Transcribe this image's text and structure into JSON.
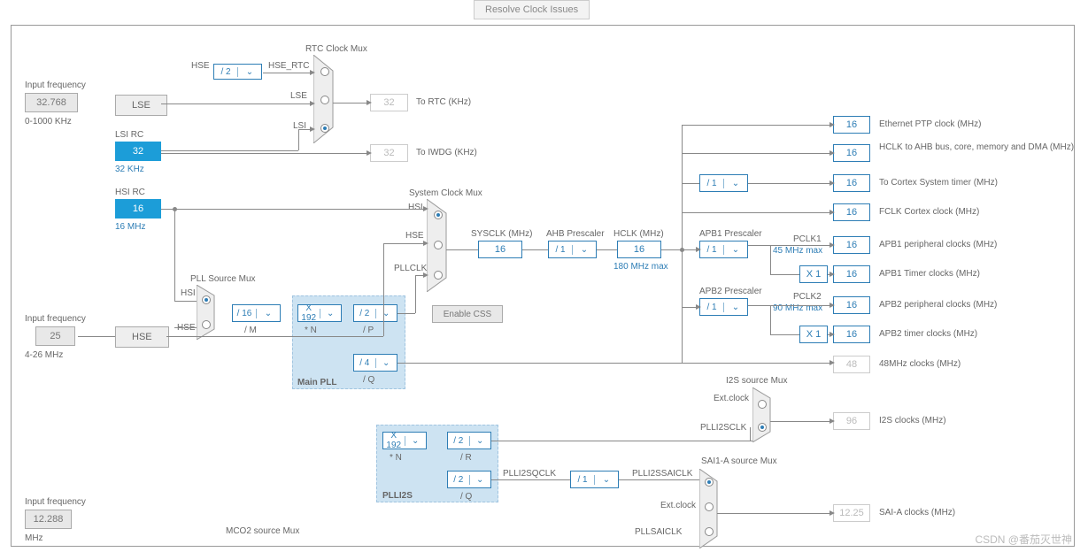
{
  "topbar": {
    "resolve": "Resolve Clock Issues"
  },
  "inputs": {
    "lse": {
      "title": "Input frequency",
      "val": "32.768",
      "range": "0-1000 KHz"
    },
    "hse": {
      "title": "Input frequency",
      "val": "25",
      "range": "4-26 MHz"
    },
    "i2s": {
      "title": "Input frequency",
      "val": "12.288",
      "range": "MHz"
    }
  },
  "src": {
    "lse": "LSE",
    "hse": "HSE",
    "lsi_rc": "LSI RC",
    "lsi_val": "32",
    "lsi_note": "32 KHz",
    "hsi_rc": "HSI RC",
    "hsi_val": "16",
    "hsi_note": "16 MHz"
  },
  "rtc": {
    "title": "RTC Clock Mux",
    "hse_div": "/ 2",
    "hse_rtc": "HSE_RTC",
    "lse": "LSE",
    "lsi": "LSI",
    "hse": "HSE",
    "to_rtc": "To RTC (KHz)",
    "rtc_val": "32",
    "to_iwdg": "To IWDG (KHz)",
    "iwdg_val": "32"
  },
  "pllsrc": {
    "title": "PLL Source Mux",
    "hsi": "HSI",
    "hse": "HSE",
    "m": "/ 16",
    "m_lbl": "/ M"
  },
  "mainpll": {
    "title": "Main PLL",
    "n": "X 192",
    "n_lbl": "* N",
    "p": "/ 2",
    "p_lbl": "/ P",
    "q": "/ 4",
    "q_lbl": "/ Q"
  },
  "plli2s": {
    "title": "PLLI2S",
    "n": "X 192",
    "n_lbl": "* N",
    "r": "/ 2",
    "r_lbl": "/ R",
    "q": "/ 2",
    "q_lbl": "/ Q"
  },
  "sysclk": {
    "title": "System Clock Mux",
    "hsi": "HSI",
    "hse": "HSE",
    "pllclk": "PLLCLK",
    "css": "Enable CSS",
    "sysclk_lbl": "SYSCLK (MHz)",
    "sysclk_val": "16"
  },
  "ahb": {
    "title": "AHB Prescaler",
    "div": "/ 1",
    "hclk_lbl": "HCLK (MHz)",
    "hclk_val": "16",
    "max": "180 MHz max"
  },
  "apb1": {
    "title": "APB1 Prescaler",
    "div": "/ 1",
    "mult": "X 1",
    "pclk": "PCLK1",
    "max": "45 MHz max"
  },
  "apb2": {
    "title": "APB2 Prescaler",
    "div": "/ 1",
    "mult": "X 1",
    "pclk": "PCLK2",
    "max": "90 MHz max"
  },
  "outs": {
    "eth": {
      "val": "16",
      "lbl": "Ethernet PTP clock (MHz)"
    },
    "hclk": {
      "val": "16",
      "lbl": "HCLK to AHB bus, core, memory and DMA (MHz)"
    },
    "systick": {
      "val": "16",
      "lbl": "To Cortex System timer (MHz)",
      "div": "/ 1"
    },
    "fclk": {
      "val": "16",
      "lbl": "FCLK Cortex clock (MHz)"
    },
    "apb1p": {
      "val": "16",
      "lbl": "APB1 peripheral clocks (MHz)"
    },
    "apb1t": {
      "val": "16",
      "lbl": "APB1 Timer clocks (MHz)"
    },
    "apb2p": {
      "val": "16",
      "lbl": "APB2 peripheral clocks (MHz)"
    },
    "apb2t": {
      "val": "16",
      "lbl": "APB2 timer clocks (MHz)"
    },
    "usb": {
      "val": "48",
      "lbl": "48MHz clocks (MHz)"
    },
    "i2s": {
      "val": "96",
      "lbl": "I2S clocks (MHz)"
    },
    "sai": {
      "val": "12.25",
      "lbl": "SAI-A clocks (MHz)"
    }
  },
  "i2smux": {
    "title": "I2S source Mux",
    "ext": "Ext.clock",
    "pll": "PLLI2SCLK"
  },
  "saimux": {
    "title": "SAI1-A source Mux",
    "sq": "PLLI2SQCLK",
    "div": "/ 1",
    "sai_out": "PLLI2SSAICLK",
    "ext": "Ext.clock",
    "pllsai": "PLLSAICLK"
  },
  "mco2": "MCO2 source Mux",
  "watermark": "CSDN @番茄灭世神"
}
